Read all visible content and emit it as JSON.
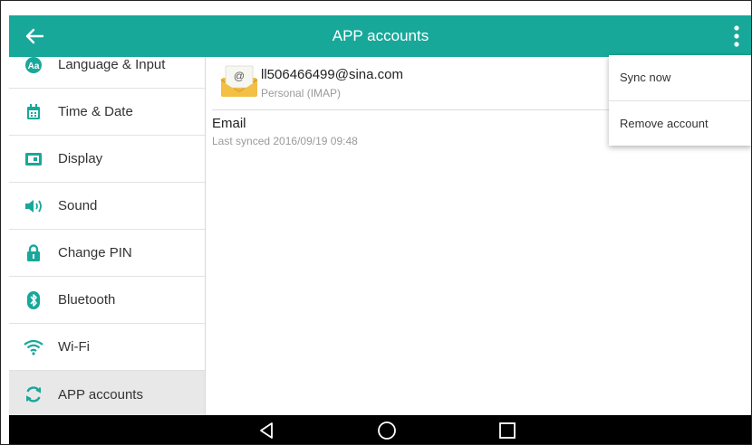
{
  "header": {
    "title": "APP accounts",
    "color": "#18a89a"
  },
  "sidebar": {
    "items": [
      {
        "label": "Language & Input",
        "icon": "language-icon"
      },
      {
        "label": "Time & Date",
        "icon": "calendar-icon"
      },
      {
        "label": "Display",
        "icon": "display-icon"
      },
      {
        "label": "Sound",
        "icon": "speaker-icon"
      },
      {
        "label": "Change PIN",
        "icon": "lock-icon"
      },
      {
        "label": "Bluetooth",
        "icon": "bluetooth-icon"
      },
      {
        "label": "Wi-Fi",
        "icon": "wifi-icon"
      },
      {
        "label": "APP accounts",
        "icon": "sync-icon",
        "active": true
      }
    ]
  },
  "account": {
    "email": "ll506466499@sina.com",
    "type": "Personal (IMAP)",
    "icon": "email-envelope-icon"
  },
  "email_section": {
    "title": "Email",
    "last_synced": "Last synced 2016/09/19 09:48"
  },
  "menu": {
    "items": [
      "Sync now",
      "Remove account"
    ]
  },
  "navbar": {
    "buttons": [
      "back-triangle-icon",
      "home-circle-icon",
      "recents-square-icon"
    ]
  }
}
